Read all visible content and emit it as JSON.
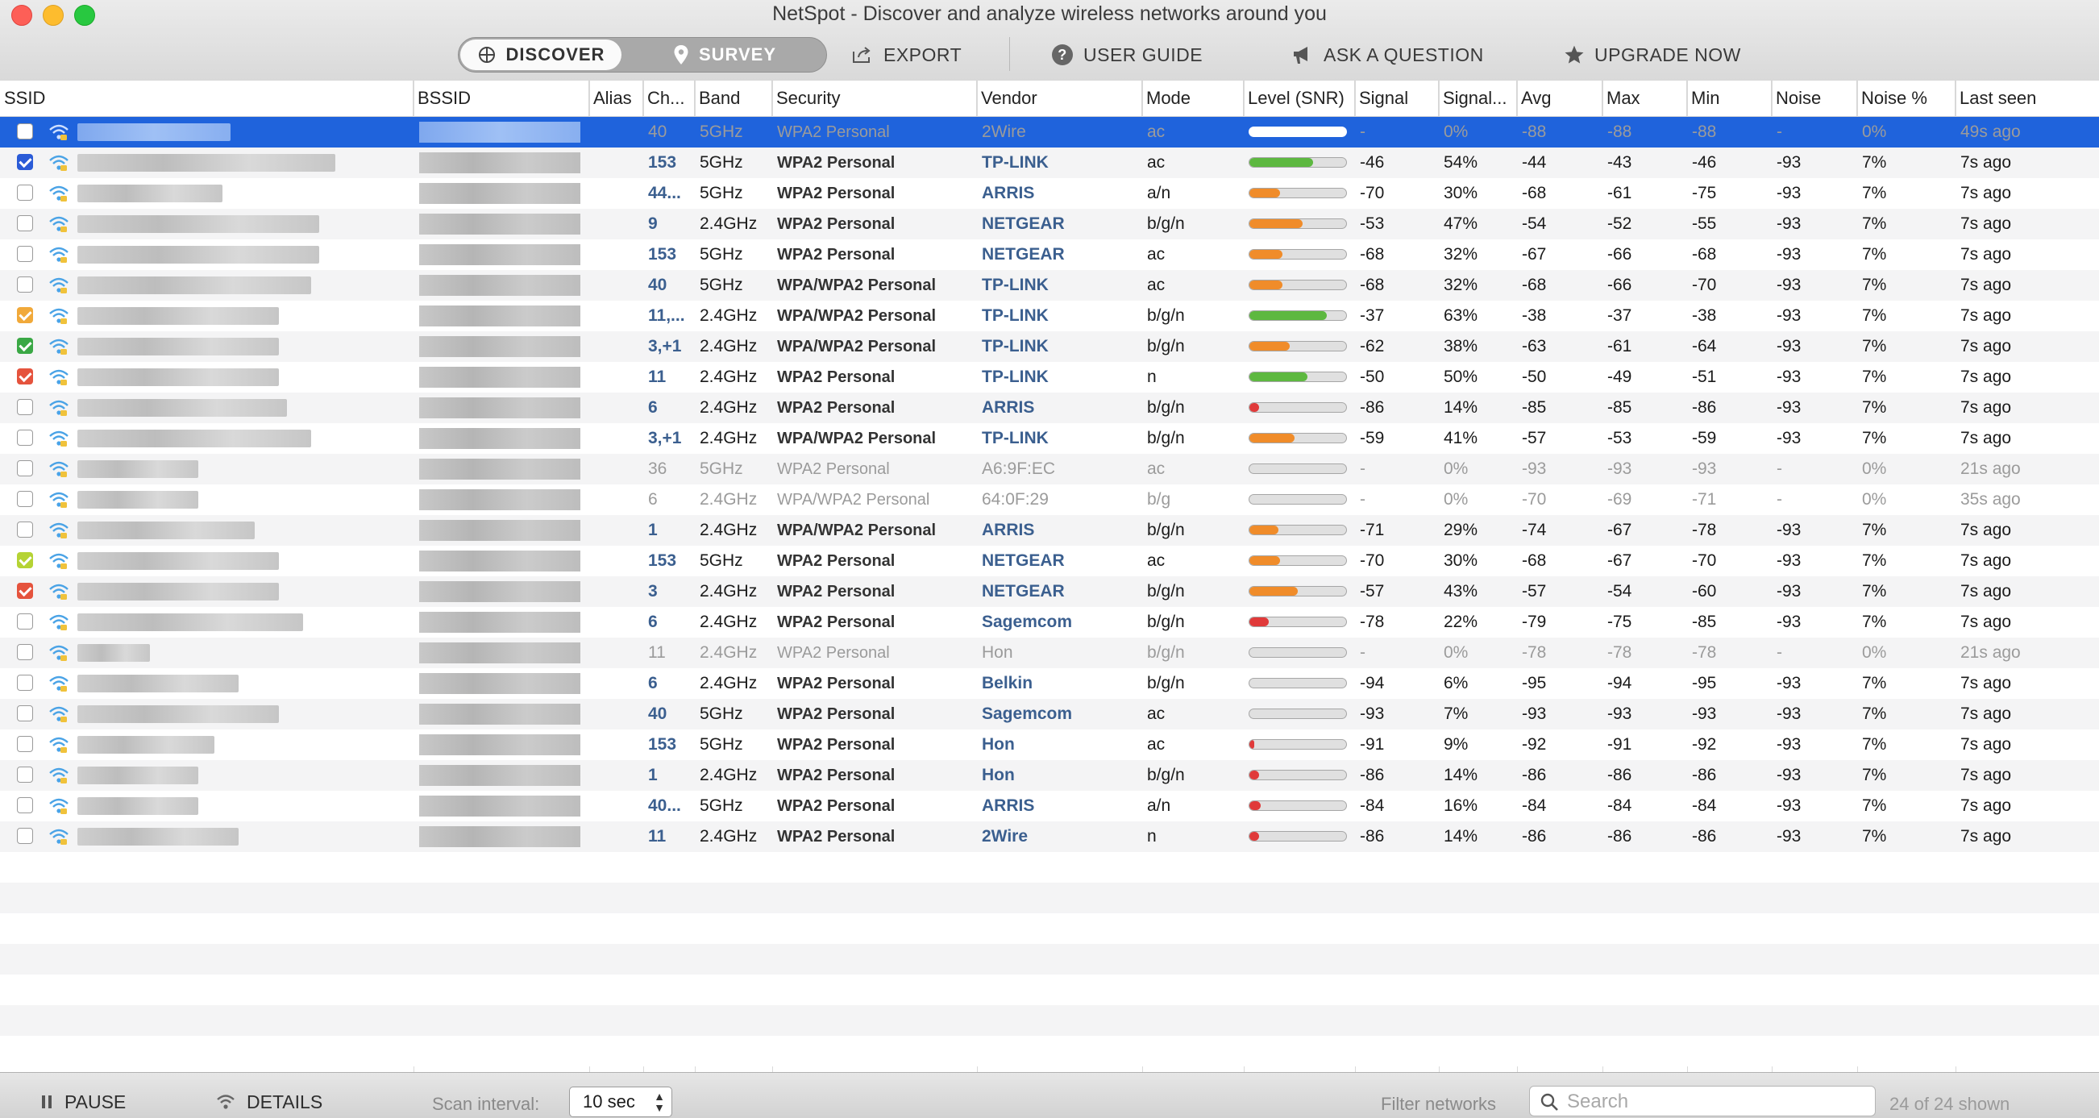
{
  "window": {
    "title": "NetSpot - Discover and analyze wireless networks around you"
  },
  "toolbar": {
    "discover": "DISCOVER",
    "survey": "SURVEY",
    "export": "EXPORT",
    "user_guide": "USER GUIDE",
    "ask_question": "ASK A QUESTION",
    "upgrade": "UPGRADE NOW"
  },
  "columns": [
    "SSID",
    "BSSID",
    "Alias",
    "Ch...",
    "Band",
    "Security",
    "Vendor",
    "Mode",
    "Level (SNR)",
    "Signal",
    "Signal...",
    "Avg",
    "Max",
    "Min",
    "Noise",
    "Noise %",
    "Last seen"
  ],
  "colors": {
    "selection": "#1f63dc",
    "vendor_link": "#3b5f8f",
    "level_green": "#5db840",
    "level_orange": "#f08c2a",
    "level_red": "#e03a3a"
  },
  "rows": [
    {
      "check": "none",
      "channel": "40",
      "band": "5GHz",
      "security": "WPA2 Personal",
      "vendor": "2Wire",
      "mode": "ac",
      "level": 0,
      "signal": "-",
      "signal_pct": "0%",
      "avg": "-88",
      "max": "-88",
      "min": "-88",
      "noise": "-",
      "noise_pct": "0%",
      "last_seen": "49s ago",
      "selected": true,
      "muted": true
    },
    {
      "check": "blue",
      "channel": "153",
      "band": "5GHz",
      "security": "WPA2 Personal",
      "vendor": "TP-LINK",
      "mode": "ac",
      "level": 0.66,
      "signal": "-46",
      "signal_pct": "54%",
      "avg": "-44",
      "max": "-43",
      "min": "-46",
      "noise": "-93",
      "noise_pct": "7%",
      "last_seen": "7s ago"
    },
    {
      "check": "none",
      "channel": "44...",
      "band": "5GHz",
      "security": "WPA2 Personal",
      "vendor": "ARRIS",
      "mode": "a/n",
      "level": 0.32,
      "signal": "-70",
      "signal_pct": "30%",
      "avg": "-68",
      "max": "-61",
      "min": "-75",
      "noise": "-93",
      "noise_pct": "7%",
      "last_seen": "7s ago"
    },
    {
      "check": "none",
      "channel": "9",
      "band": "2.4GHz",
      "security": "WPA2 Personal",
      "vendor": "NETGEAR",
      "mode": "b/g/n",
      "level": 0.55,
      "signal": "-53",
      "signal_pct": "47%",
      "avg": "-54",
      "max": "-52",
      "min": "-55",
      "noise": "-93",
      "noise_pct": "7%",
      "last_seen": "7s ago"
    },
    {
      "check": "none",
      "channel": "153",
      "band": "5GHz",
      "security": "WPA2 Personal",
      "vendor": "NETGEAR",
      "mode": "ac",
      "level": 0.34,
      "signal": "-68",
      "signal_pct": "32%",
      "avg": "-67",
      "max": "-66",
      "min": "-68",
      "noise": "-93",
      "noise_pct": "7%",
      "last_seen": "7s ago"
    },
    {
      "check": "none",
      "channel": "40",
      "band": "5GHz",
      "security": "WPA/WPA2 Personal",
      "vendor": "TP-LINK",
      "mode": "ac",
      "level": 0.34,
      "signal": "-68",
      "signal_pct": "32%",
      "avg": "-68",
      "max": "-66",
      "min": "-70",
      "noise": "-93",
      "noise_pct": "7%",
      "last_seen": "7s ago"
    },
    {
      "check": "orange",
      "channel": "11,...",
      "band": "2.4GHz",
      "security": "WPA/WPA2 Personal",
      "vendor": "TP-LINK",
      "mode": "b/g/n",
      "level": 0.8,
      "signal": "-37",
      "signal_pct": "63%",
      "avg": "-38",
      "max": "-37",
      "min": "-38",
      "noise": "-93",
      "noise_pct": "7%",
      "last_seen": "7s ago"
    },
    {
      "check": "green",
      "channel": "3,+1",
      "band": "2.4GHz",
      "security": "WPA/WPA2 Personal",
      "vendor": "TP-LINK",
      "mode": "b/g/n",
      "level": 0.42,
      "signal": "-62",
      "signal_pct": "38%",
      "avg": "-63",
      "max": "-61",
      "min": "-64",
      "noise": "-93",
      "noise_pct": "7%",
      "last_seen": "7s ago"
    },
    {
      "check": "red",
      "channel": "11",
      "band": "2.4GHz",
      "security": "WPA2 Personal",
      "vendor": "TP-LINK",
      "mode": "n",
      "level": 0.6,
      "signal": "-50",
      "signal_pct": "50%",
      "avg": "-50",
      "max": "-49",
      "min": "-51",
      "noise": "-93",
      "noise_pct": "7%",
      "last_seen": "7s ago"
    },
    {
      "check": "none",
      "channel": "6",
      "band": "2.4GHz",
      "security": "WPA2 Personal",
      "vendor": "ARRIS",
      "mode": "b/g/n",
      "level": 0.1,
      "signal": "-86",
      "signal_pct": "14%",
      "avg": "-85",
      "max": "-85",
      "min": "-86",
      "noise": "-93",
      "noise_pct": "7%",
      "last_seen": "7s ago"
    },
    {
      "check": "none",
      "channel": "3,+1",
      "band": "2.4GHz",
      "security": "WPA/WPA2 Personal",
      "vendor": "TP-LINK",
      "mode": "b/g/n",
      "level": 0.47,
      "signal": "-59",
      "signal_pct": "41%",
      "avg": "-57",
      "max": "-53",
      "min": "-59",
      "noise": "-93",
      "noise_pct": "7%",
      "last_seen": "7s ago"
    },
    {
      "check": "none",
      "channel": "36",
      "band": "5GHz",
      "security": "WPA2 Personal",
      "vendor": "A6:9F:EC",
      "mode": "ac",
      "level": 0,
      "signal": "-",
      "signal_pct": "0%",
      "avg": "-93",
      "max": "-93",
      "min": "-93",
      "noise": "-",
      "noise_pct": "0%",
      "last_seen": "21s ago",
      "muted": true
    },
    {
      "check": "none",
      "channel": "6",
      "band": "2.4GHz",
      "security": "WPA/WPA2 Personal",
      "vendor": "64:0F:29",
      "mode": "b/g",
      "level": 0,
      "signal": "-",
      "signal_pct": "0%",
      "avg": "-70",
      "max": "-69",
      "min": "-71",
      "noise": "-",
      "noise_pct": "0%",
      "last_seen": "35s ago",
      "muted": true
    },
    {
      "check": "none",
      "channel": "1",
      "band": "2.4GHz",
      "security": "WPA/WPA2 Personal",
      "vendor": "ARRIS",
      "mode": "b/g/n",
      "level": 0.3,
      "signal": "-71",
      "signal_pct": "29%",
      "avg": "-74",
      "max": "-67",
      "min": "-78",
      "noise": "-93",
      "noise_pct": "7%",
      "last_seen": "7s ago"
    },
    {
      "check": "lime",
      "channel": "153",
      "band": "5GHz",
      "security": "WPA2 Personal",
      "vendor": "NETGEAR",
      "mode": "ac",
      "level": 0.32,
      "signal": "-70",
      "signal_pct": "30%",
      "avg": "-68",
      "max": "-67",
      "min": "-70",
      "noise": "-93",
      "noise_pct": "7%",
      "last_seen": "7s ago"
    },
    {
      "check": "red",
      "channel": "3",
      "band": "2.4GHz",
      "security": "WPA2 Personal",
      "vendor": "NETGEAR",
      "mode": "b/g/n",
      "level": 0.5,
      "signal": "-57",
      "signal_pct": "43%",
      "avg": "-57",
      "max": "-54",
      "min": "-60",
      "noise": "-93",
      "noise_pct": "7%",
      "last_seen": "7s ago"
    },
    {
      "check": "none",
      "channel": "6",
      "band": "2.4GHz",
      "security": "WPA2 Personal",
      "vendor": "Sagemcom",
      "mode": "b/g/n",
      "level": 0.2,
      "signal": "-78",
      "signal_pct": "22%",
      "avg": "-79",
      "max": "-75",
      "min": "-85",
      "noise": "-93",
      "noise_pct": "7%",
      "last_seen": "7s ago"
    },
    {
      "check": "none",
      "channel": "11",
      "band": "2.4GHz",
      "security": "WPA2 Personal",
      "vendor": "Hon",
      "mode": "b/g/n",
      "level": 0,
      "signal": "-",
      "signal_pct": "0%",
      "avg": "-78",
      "max": "-78",
      "min": "-78",
      "noise": "-",
      "noise_pct": "0%",
      "last_seen": "21s ago",
      "muted": true
    },
    {
      "check": "none",
      "channel": "6",
      "band": "2.4GHz",
      "security": "WPA2 Personal",
      "vendor": "Belkin",
      "mode": "b/g/n",
      "level": 0,
      "signal": "-94",
      "signal_pct": "6%",
      "avg": "-95",
      "max": "-94",
      "min": "-95",
      "noise": "-93",
      "noise_pct": "7%",
      "last_seen": "7s ago"
    },
    {
      "check": "none",
      "channel": "40",
      "band": "5GHz",
      "security": "WPA2 Personal",
      "vendor": "Sagemcom",
      "mode": "ac",
      "level": 0,
      "signal": "-93",
      "signal_pct": "7%",
      "avg": "-93",
      "max": "-93",
      "min": "-93",
      "noise": "-93",
      "noise_pct": "7%",
      "last_seen": "7s ago"
    },
    {
      "check": "none",
      "channel": "153",
      "band": "5GHz",
      "security": "WPA2 Personal",
      "vendor": "Hon",
      "mode": "ac",
      "level": 0.03,
      "signal": "-91",
      "signal_pct": "9%",
      "avg": "-92",
      "max": "-91",
      "min": "-92",
      "noise": "-93",
      "noise_pct": "7%",
      "last_seen": "7s ago"
    },
    {
      "check": "none",
      "channel": "1",
      "band": "2.4GHz",
      "security": "WPA2 Personal",
      "vendor": "Hon",
      "mode": "b/g/n",
      "level": 0.1,
      "signal": "-86",
      "signal_pct": "14%",
      "avg": "-86",
      "max": "-86",
      "min": "-86",
      "noise": "-93",
      "noise_pct": "7%",
      "last_seen": "7s ago"
    },
    {
      "check": "none",
      "channel": "40...",
      "band": "5GHz",
      "security": "WPA2 Personal",
      "vendor": "ARRIS",
      "mode": "a/n",
      "level": 0.12,
      "signal": "-84",
      "signal_pct": "16%",
      "avg": "-84",
      "max": "-84",
      "min": "-84",
      "noise": "-93",
      "noise_pct": "7%",
      "last_seen": "7s ago"
    },
    {
      "check": "none",
      "channel": "11",
      "band": "2.4GHz",
      "security": "WPA2 Personal",
      "vendor": "2Wire",
      "mode": "n",
      "level": 0.1,
      "signal": "-86",
      "signal_pct": "14%",
      "avg": "-86",
      "max": "-86",
      "min": "-86",
      "noise": "-93",
      "noise_pct": "7%",
      "last_seen": "7s ago"
    }
  ],
  "bottombar": {
    "pause": "PAUSE",
    "details": "DETAILS",
    "scan_interval_label": "Scan interval:",
    "scan_interval_value": "10 sec",
    "filter_label": "Filter networks",
    "search_placeholder": "Search",
    "shown": "24 of 24 shown"
  }
}
